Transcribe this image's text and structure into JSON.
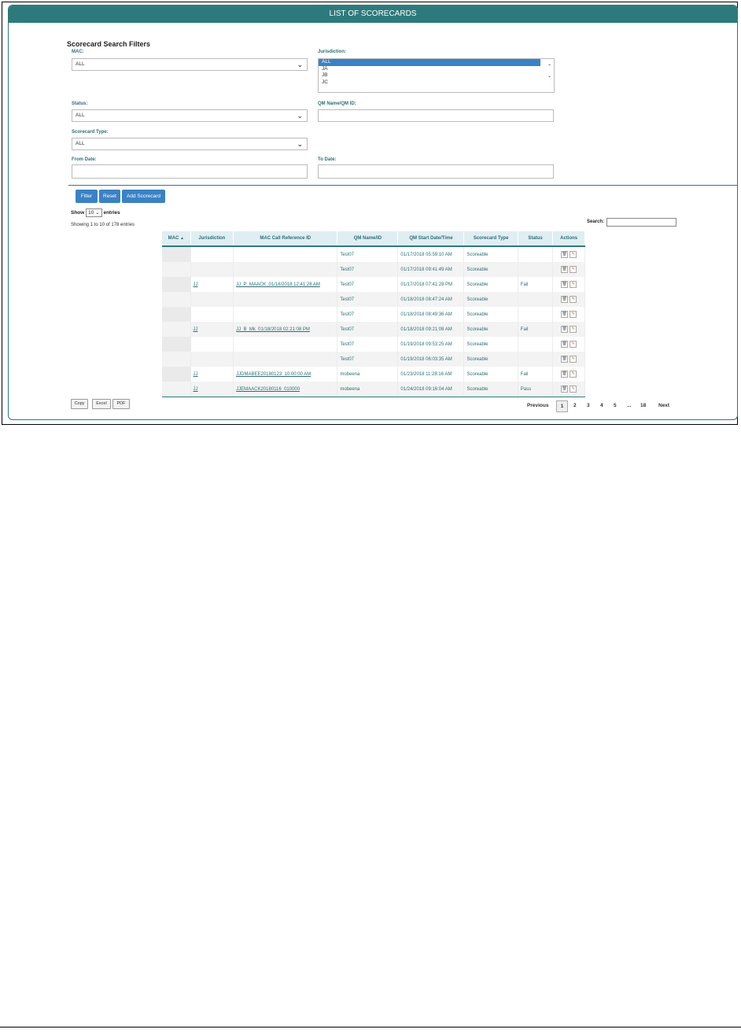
{
  "title": "LIST OF SCORECARDS",
  "filters": {
    "heading": "Scorecard Search Filters",
    "mac": {
      "label": "MAC:",
      "value": "ALL"
    },
    "jurisdiction": {
      "label": "Jurisdiction:",
      "options": [
        "ALL",
        "JA",
        "JB",
        "JC"
      ],
      "selected": "ALL"
    },
    "status": {
      "label": "Status:",
      "value": "ALL"
    },
    "qm_name": {
      "label": "QM Name/QM ID:",
      "value": ""
    },
    "scorecard_type": {
      "label": "Scorecard Type:",
      "value": "ALL"
    },
    "from_date": {
      "label": "From Date:",
      "value": ""
    },
    "to_date": {
      "label": "To Date:",
      "value": ""
    }
  },
  "buttons": {
    "filter": "Filter",
    "reset": "Reset",
    "add": "Add Scorecard"
  },
  "length": {
    "show": "Show",
    "value": "10",
    "entries": "entries"
  },
  "info": "Showing 1 to 10 of 178 entries",
  "search": {
    "label": "Search:",
    "value": ""
  },
  "table": {
    "columns": [
      "MAC",
      "Jurisdiction",
      "MAC Call Reference ID",
      "QM Name/ID",
      "QM Start Date/Time",
      "Scorecard Type",
      "Status",
      "Actions"
    ],
    "rows": [
      {
        "mac": "",
        "jur": "",
        "ref": "",
        "qm": "Test07",
        "date": "01/17/2018 05:59:10 AM",
        "type": "Scoreable",
        "status": ""
      },
      {
        "mac": "",
        "jur": "",
        "ref": "",
        "qm": "Test07",
        "date": "01/17/2018 09:41:49 AM",
        "type": "Scoreable",
        "status": ""
      },
      {
        "mac": "",
        "jur": "JJ",
        "ref": "JJ_P_MAACK_01/18/2018 12:41:28 AM",
        "qm": "Test07",
        "date": "01/17/2018 07:41:28 PM",
        "type": "Scoreable",
        "status": "Fail"
      },
      {
        "mac": "",
        "jur": "",
        "ref": "",
        "qm": "Test07",
        "date": "01/18/2018 08:47:24 AM",
        "type": "Scoreable",
        "status": ""
      },
      {
        "mac": "",
        "jur": "",
        "ref": "",
        "qm": "Test07",
        "date": "01/18/2018 08:49:36 AM",
        "type": "Scoreable",
        "status": ""
      },
      {
        "mac": "",
        "jur": "JJ",
        "ref": "JJ_B_Mk_01/18/2018 02:21:08 PM",
        "qm": "Test07",
        "date": "01/18/2018 09:21:08 AM",
        "type": "Scoreable",
        "status": "Fail"
      },
      {
        "mac": "",
        "jur": "",
        "ref": "",
        "qm": "Test07",
        "date": "01/19/2018 09:53:25 AM",
        "type": "Scoreable",
        "status": ""
      },
      {
        "mac": "",
        "jur": "",
        "ref": "",
        "qm": "Test07",
        "date": "01/19/2018 06:03:35 AM",
        "type": "Scoreable",
        "status": ""
      },
      {
        "mac": "",
        "jur": "JJ",
        "ref": "JJDMABEE20180123_10:00:00 AM",
        "qm": "mobeena",
        "date": "01/23/2018 11:28:16 AM",
        "type": "Scoreable",
        "status": "Fail"
      },
      {
        "mac": "",
        "jur": "JJ",
        "ref": "JJEMAACK20180116_010000",
        "qm": "mobeena",
        "date": "01/24/2018 09:16:04 AM",
        "type": "Scoreable",
        "status": "Pass"
      }
    ]
  },
  "export": {
    "copy": "Copy",
    "excel": "Excel",
    "pdf": "PDF"
  },
  "pagination": {
    "previous": "Previous",
    "pages": [
      "1",
      "2",
      "3",
      "4",
      "5",
      "...",
      "18"
    ],
    "next": "Next",
    "current": "1"
  },
  "icons": {
    "sort": "sort-asc-icon",
    "dropdown": "chevron-down-icon",
    "delete": "trash-icon",
    "edit": "pencil-icon"
  }
}
